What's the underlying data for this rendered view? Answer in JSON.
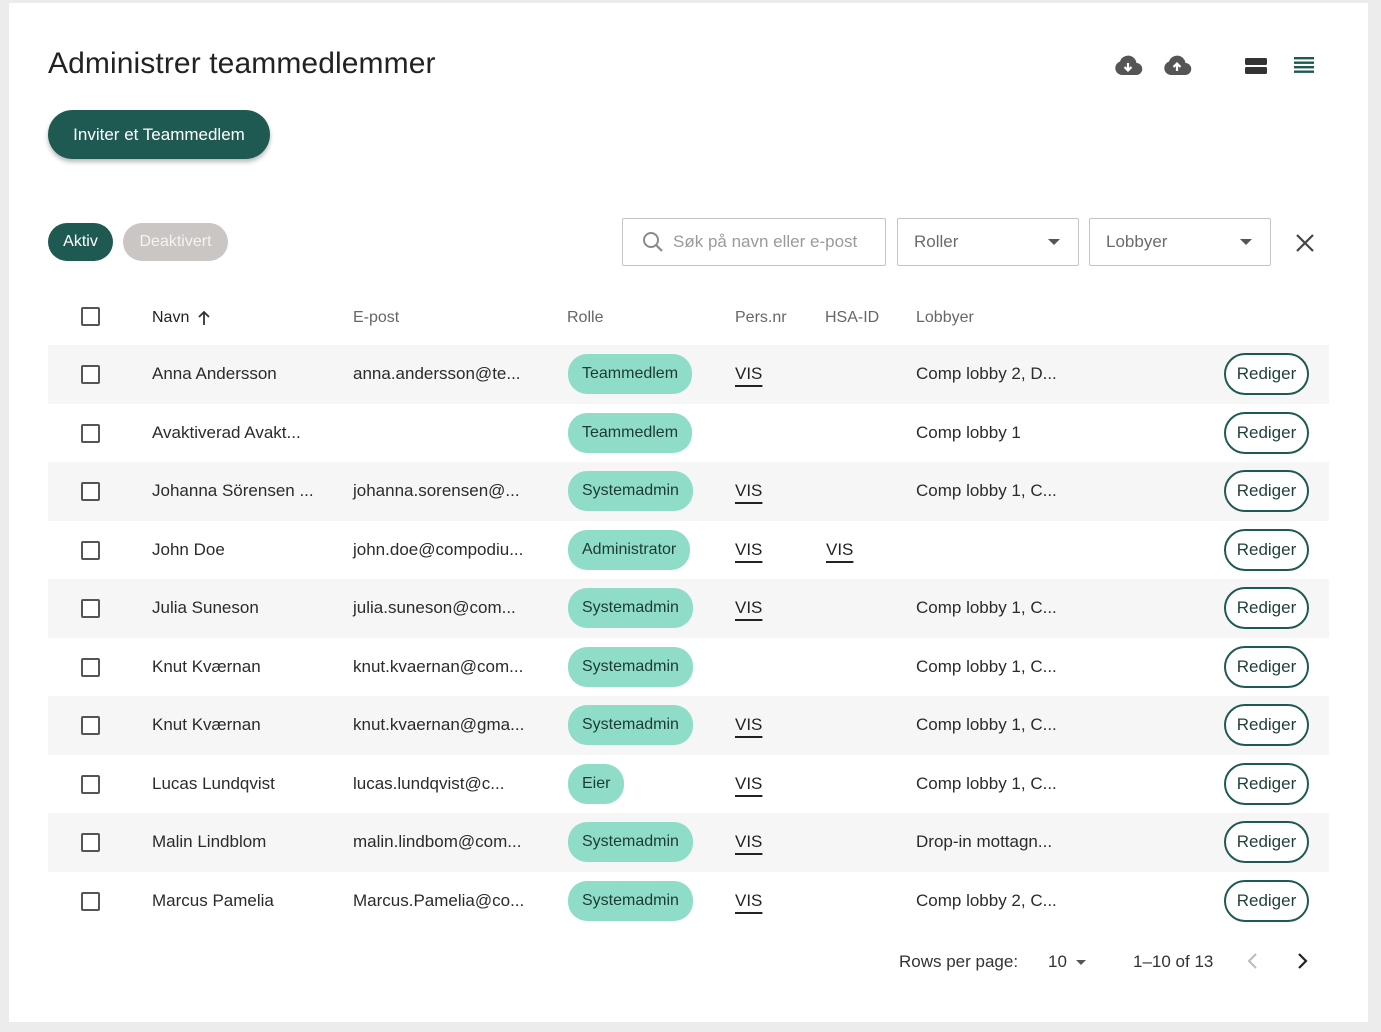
{
  "header": {
    "title": "Administrer teammedlemmer"
  },
  "toolbar_icons": [
    "cloud-download-icon",
    "cloud-upload-icon",
    "comfortable-density-icon",
    "compact-density-icon"
  ],
  "invite_button": "Inviter et Teammedlem",
  "status_tabs": {
    "active": "Aktiv",
    "inactive": "Deaktivert"
  },
  "filters": {
    "search_placeholder": "Søk på navn eller e-post",
    "roles": "Roller",
    "lobbies": "Lobbyer"
  },
  "columns": {
    "name": "Navn",
    "email": "E-post",
    "role": "Rolle",
    "pers": "Pers.nr",
    "hsa": "HSA-ID",
    "lobbies": "Lobbyer"
  },
  "edit_label": "Rediger",
  "rows": [
    {
      "name": "Anna Andersson",
      "email": "anna.andersson@te...",
      "role": "Teammedlem",
      "pers": "VIS",
      "hsa": "",
      "lobbies": "Comp lobby 2, D..."
    },
    {
      "name": "Avaktiverad Avakt...",
      "email": "",
      "role": "Teammedlem",
      "pers": "",
      "hsa": "",
      "lobbies": "Comp lobby 1"
    },
    {
      "name": "Johanna Sörensen ...",
      "email": "johanna.sorensen@...",
      "role": "Systemadmin",
      "pers": "VIS",
      "hsa": "",
      "lobbies": "Comp lobby 1, C..."
    },
    {
      "name": "John Doe",
      "email": "john.doe@compodiu...",
      "role": "Administrator",
      "pers": "VIS",
      "hsa": "VIS",
      "lobbies": ""
    },
    {
      "name": "Julia Suneson",
      "email": "julia.suneson@com...",
      "role": "Systemadmin",
      "pers": "VIS",
      "hsa": "",
      "lobbies": "Comp lobby 1, C..."
    },
    {
      "name": "Knut Kværnan",
      "email": "knut.kvaernan@com...",
      "role": "Systemadmin",
      "pers": "",
      "hsa": "",
      "lobbies": "Comp lobby 1, C..."
    },
    {
      "name": "Knut Kværnan",
      "email": "knut.kvaernan@gma...",
      "role": "Systemadmin",
      "pers": "VIS",
      "hsa": "",
      "lobbies": "Comp lobby 1, C..."
    },
    {
      "name": "Lucas Lundqvist",
      "email": "lucas.lundqvist@c...",
      "role": "Eier",
      "pers": "VIS",
      "hsa": "",
      "lobbies": "Comp lobby 1, C..."
    },
    {
      "name": "Malin Lindblom",
      "email": "malin.lindbom@com...",
      "role": "Systemadmin",
      "pers": "VIS",
      "hsa": "",
      "lobbies": "Drop-in mottagn..."
    },
    {
      "name": "Marcus Pamelia",
      "email": "Marcus.Pamelia@co...",
      "role": "Systemadmin",
      "pers": "VIS",
      "hsa": "",
      "lobbies": "Comp lobby 2, C..."
    }
  ],
  "pagination": {
    "rows_per_page_label": "Rows per page:",
    "rows_per_page": "10",
    "range": "1–10 of 13"
  },
  "colors": {
    "accent": "#1f5a52",
    "chip": "#8fdcc8",
    "inactive_pill": "#c9c6c3"
  }
}
